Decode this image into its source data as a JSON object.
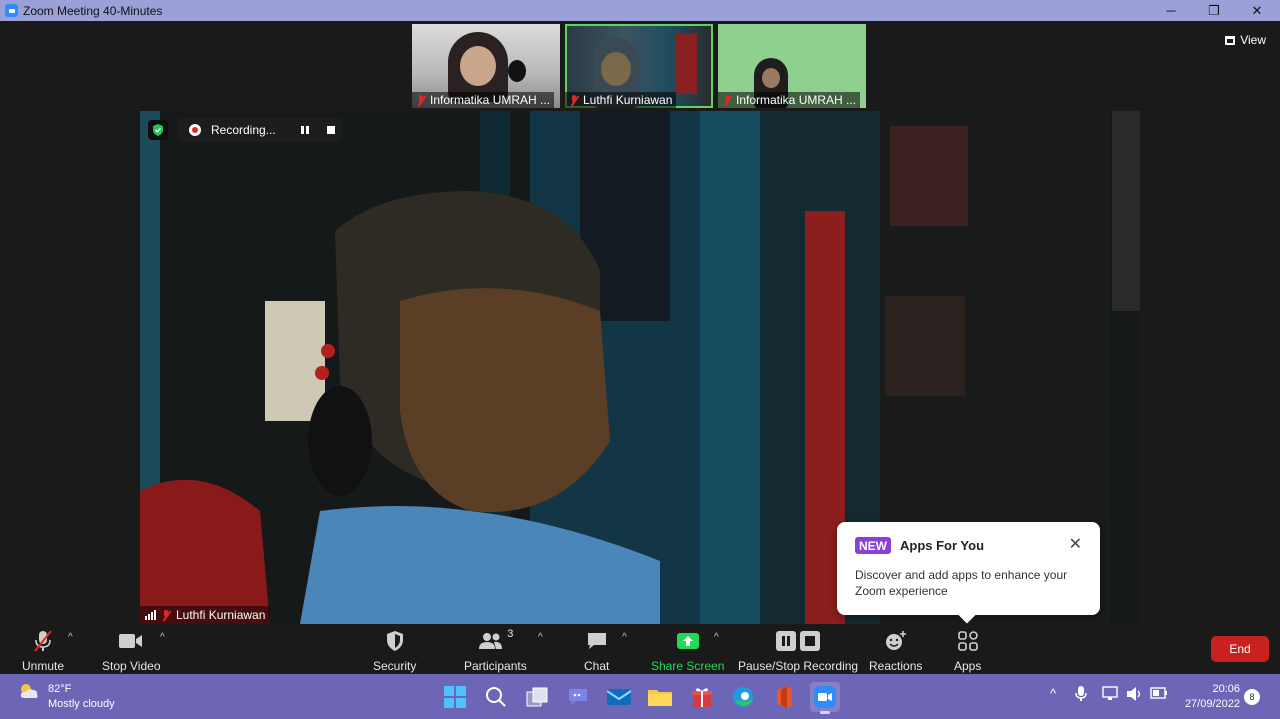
{
  "window": {
    "title": "Zoom Meeting 40-Minutes",
    "minimize": "─",
    "restore": "❐",
    "close": "✕"
  },
  "view": {
    "label": "View"
  },
  "thumbnails": [
    {
      "name": "Informatika UMRAH ..."
    },
    {
      "name": "Luthfi Kurniawan"
    },
    {
      "name": "Informatika UMRAH ..."
    }
  ],
  "recording": {
    "status": "Recording..."
  },
  "main_video": {
    "name": "Luthfi Kurniawan"
  },
  "popup": {
    "badge": "NEW",
    "title": "Apps For You",
    "description": "Discover and add apps to enhance your Zoom experience",
    "close": "✕"
  },
  "toolbar": {
    "unmute": "Unmute",
    "stop_video": "Stop Video",
    "security": "Security",
    "participants": "Participants",
    "participants_count": "3",
    "chat": "Chat",
    "share_screen": "Share Screen",
    "pause_stop_recording": "Pause/Stop Recording",
    "reactions": "Reactions",
    "apps": "Apps",
    "end": "End"
  },
  "colors": {
    "share_green": "#23d959",
    "end_red": "#c8211f",
    "taskbar": "#6d65b6",
    "titlebar": "#9ba0d9"
  },
  "taskbar": {
    "weather_temp": "82°F",
    "weather_desc": "Mostly cloudy",
    "time": "20:06",
    "date": "27/09/2022",
    "notification_count": "8"
  }
}
